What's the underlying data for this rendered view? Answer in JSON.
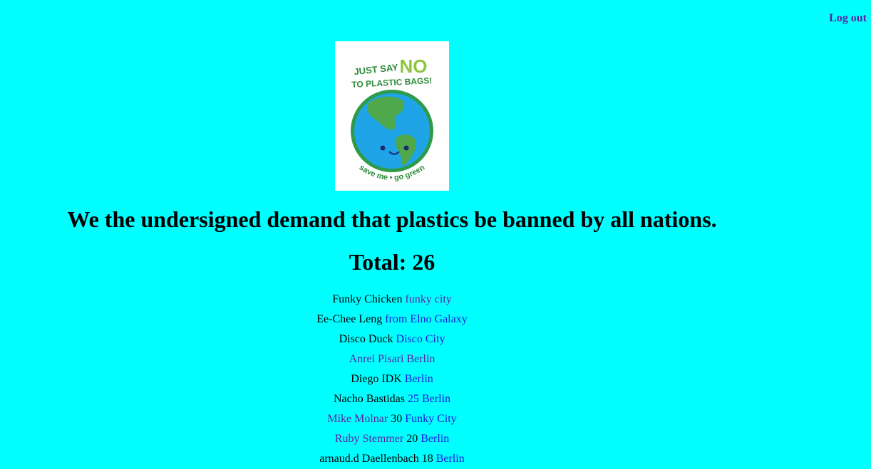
{
  "header": {
    "logout_label": "Log out"
  },
  "poster": {
    "line1_a": "JUST SAY",
    "line1_b": "NO",
    "line2": "TO PLASTIC BAGS!",
    "caption": "save me • go green"
  },
  "petition": {
    "headline": "We the undersigned demand that plastics be banned by all nations.",
    "total_label": "Total: 26"
  },
  "signers": [
    {
      "name": "Funky Chicken",
      "age": "",
      "city": "funky city"
    },
    {
      "name": "Ee-Chee Leng",
      "age": "",
      "city": "from Elno Galaxy"
    },
    {
      "name": "Disco Duck",
      "age": "",
      "city": "Disco City"
    },
    {
      "name": "Anrei Pisari",
      "age": "",
      "city": "Berlin"
    },
    {
      "name": "Diego IDK",
      "age": "",
      "city": "Berlin"
    },
    {
      "name": "Nacho Bastidas",
      "age": "25",
      "city": "Berlin"
    },
    {
      "name": "Mike Molnar",
      "age": "30",
      "city": "Funky City"
    },
    {
      "name": "Ruby Stemmer",
      "age": "20",
      "city": "Berlin"
    },
    {
      "name": "arnaud.d Daellenbach",
      "age": "18",
      "city": "Berlin"
    }
  ],
  "colors": {
    "background": "#00ffff",
    "link_visited": "#5a1fa0",
    "link": "#1a1adf"
  }
}
